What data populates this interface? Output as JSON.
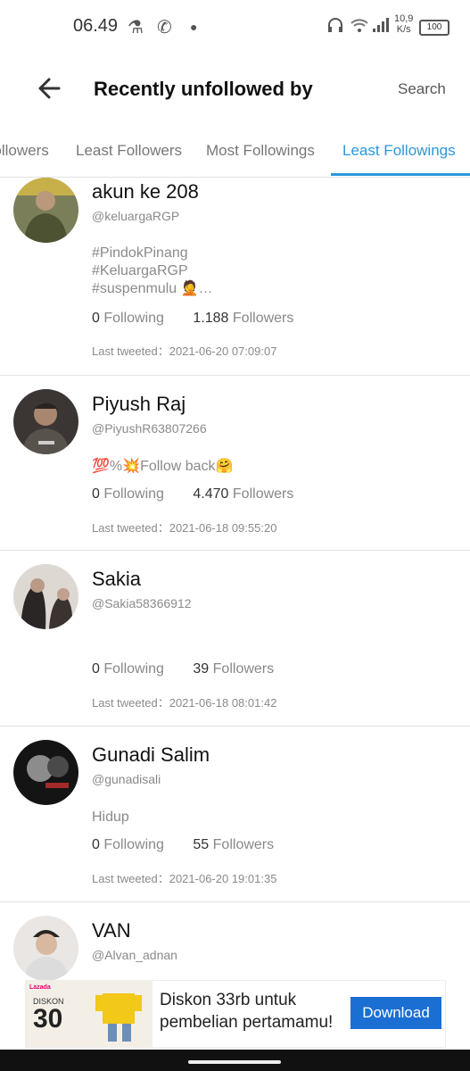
{
  "status": {
    "time": "06.49",
    "speed_top": "10,9",
    "speed_unit": "K/s",
    "battery": "100"
  },
  "header": {
    "title": "Recently unfollowed by",
    "search_label": "Search"
  },
  "tabs": [
    "Followers",
    "Least Followers",
    "Most Followings",
    "Least Followings"
  ],
  "users": [
    {
      "name": "akun ke 208",
      "handle": "@keluargaRGP",
      "bio": [
        "#PindokPinang",
        "#KeluargaRGP",
        "#suspenmulu 🤦…"
      ],
      "following": "0",
      "following_label": "Following",
      "followers": "1.188",
      "followers_label": "Followers",
      "last_tweeted": "Last tweeted：2021-06-20 07:09:07"
    },
    {
      "name": "Piyush Raj",
      "handle": "@PiyushR63807266",
      "bio": [
        "💯%💥Follow back🤗"
      ],
      "following": "0",
      "following_label": "Following",
      "followers": "4.470",
      "followers_label": "Followers",
      "last_tweeted": "Last tweeted：2021-06-18 09:55:20"
    },
    {
      "name": "Sakia",
      "handle": "@Sakia58366912",
      "bio": [],
      "following": "0",
      "following_label": "Following",
      "followers": "39",
      "followers_label": "Followers",
      "last_tweeted": "Last tweeted：2021-06-18 08:01:42"
    },
    {
      "name": "Gunadi Salim",
      "handle": "@gunadisali",
      "bio": [
        "Hidup"
      ],
      "following": "0",
      "following_label": "Following",
      "followers": "55",
      "followers_label": "Followers",
      "last_tweeted": "Last tweeted：2021-06-20 19:01:35"
    },
    {
      "name": "VAN",
      "handle": "@Alvan_adnan",
      "bio": [],
      "following": "",
      "following_label": "",
      "followers": "",
      "followers_label": "",
      "last_tweeted": ""
    }
  ],
  "ad": {
    "brand": "Lazada",
    "promo": "DISKON",
    "promo_value": "30",
    "text": "Diskon 33rb untuk pembelian pertamamu!",
    "button": "Download"
  },
  "colors": {
    "accent": "#2b98d8",
    "ad_button": "#1b6fd3"
  }
}
